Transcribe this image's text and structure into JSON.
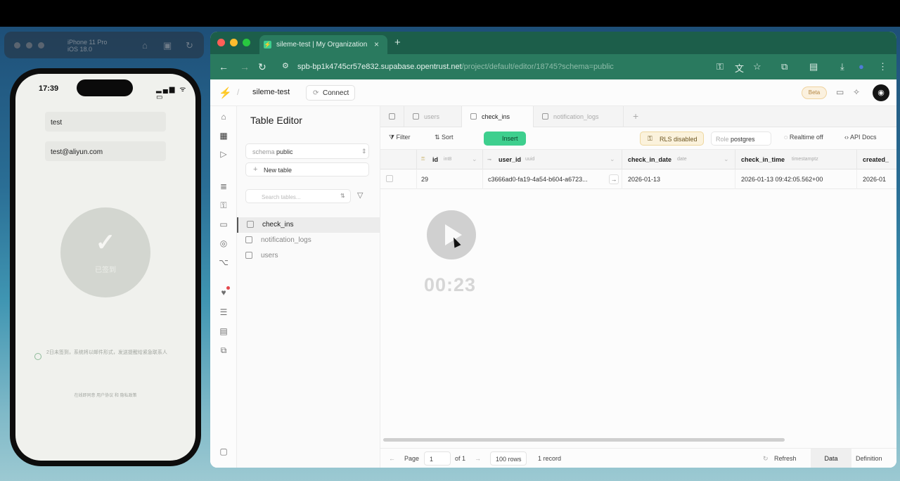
{
  "simulator": {
    "device_name": "iPhone 11 Pro",
    "device_os": "iOS 18.0",
    "status_time": "17:39",
    "status_icons": "▂▄▆ ᯤ ▭",
    "name_input": "test",
    "email_input": "test@aliyun.com",
    "checkin_icon": "✓",
    "checkin_label": "已签到",
    "note_text": "2日未签到，系统将以邮件形式，发送提醒给紧急联系人",
    "footer_text": "在线即同意 用户协议 和 隐私政策"
  },
  "browser": {
    "tab_title": "sileme-test | My Organization",
    "tab_icon": "⚡",
    "url_host": "spb-bp1k4745cr57e832.supabase.opentrust.net",
    "url_path": "/project/default/editor/18745?schema=public"
  },
  "app": {
    "project_name": "sileme-test",
    "connect_label": "Connect",
    "beta_label": "Beta",
    "avatar_glyph": "◉",
    "panel_title": "Table Editor",
    "schema_prefix": "schema",
    "schema_value": "public",
    "new_table_label": "New table",
    "search_placeholder": "Search tables...",
    "tables": [
      "check_ins",
      "notification_logs",
      "users"
    ],
    "editor_tabs": [
      "users",
      "check_ins",
      "notification_logs"
    ],
    "toolbar": {
      "filter": "Filter",
      "sort": "Sort",
      "insert": "Insert",
      "rls": "RLS disabled",
      "role_prefix": "Role",
      "role_value": "postgres",
      "realtime": "Realtime off",
      "api_docs": "API Docs"
    },
    "columns": [
      {
        "name": "id",
        "type": "int8"
      },
      {
        "name": "user_id",
        "type": "uuid"
      },
      {
        "name": "check_in_date",
        "type": "date"
      },
      {
        "name": "check_in_time",
        "type": "timestamptz"
      },
      {
        "name": "created_",
        "type": ""
      }
    ],
    "rows": [
      {
        "id": "29",
        "user_id": "c3666ad0-fa19-4a54-b604-a6723...",
        "check_in_date": "2026-01-13",
        "check_in_time": "2026-01-13 09:42:05.562+00",
        "created": "2026-01"
      }
    ],
    "footer": {
      "page_label": "Page",
      "page_value": "1",
      "of_label": "of 1",
      "rows_label": "100 rows",
      "records": "1 record",
      "refresh": "Refresh",
      "data_tab": "Data",
      "definition_tab": "Definition"
    }
  },
  "video_overlay": {
    "timestamp": "00:23"
  },
  "colors": {
    "supabase_green": "#3ecf8e",
    "browser_chrome": "#2a7a5f",
    "rls_warning": "#fbf2dc"
  }
}
